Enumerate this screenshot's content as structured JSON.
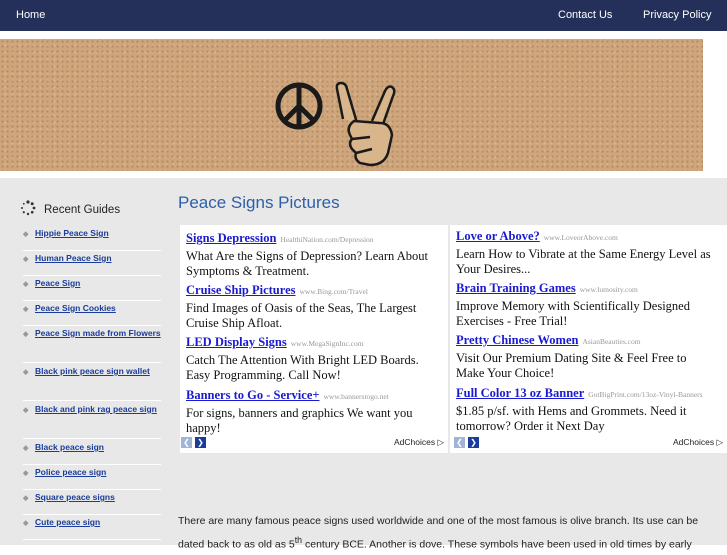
{
  "nav": {
    "home": "Home",
    "contact": "Contact Us",
    "privacy": "Privacy Policy"
  },
  "sidebar": {
    "heading": "Recent Guides",
    "items": [
      "Hippie Peace Sign",
      "Human Peace Sign",
      "Peace Sign",
      "Peace Sign Cookies",
      "Peace Sign made from Flowers",
      "Black pink peace sign wallet",
      "Black and pink rag peace sign",
      "Black peace sign",
      "Police peace sign",
      "Square peace signs",
      "Cute peace sign"
    ]
  },
  "page_title": "Peace Signs Pictures",
  "ads_left": [
    {
      "title": "Signs Depression",
      "url": "HealthiNation.com/Depression",
      "desc": "What Are the Signs of Depression? Learn About Symptoms & Treatment."
    },
    {
      "title": "Cruise Ship Pictures",
      "url": "www.Bing.com/Travel",
      "desc": "Find Images of Oasis of the Seas, The Largest Cruise Ship Afloat."
    },
    {
      "title": "LED Display Signs",
      "url": "www.MegaSignInc.com",
      "desc": "Catch The Attention With Bright LED Boards. Easy Programming. Call Now!"
    },
    {
      "title": "Banners to Go - Service+",
      "url": "www.bannerstogo.net",
      "desc": "For signs, banners and graphics We want you happy!"
    }
  ],
  "ads_right": [
    {
      "title": "Love or Above?",
      "url": "www.LoveorAbove.com",
      "desc": "Learn How to Vibrate at the Same Energy Level as Your Desires..."
    },
    {
      "title": "Brain Training Games",
      "url": "www.lumosity.com",
      "desc": "Improve Memory with Scientifically Designed Exercises - Free Trial!"
    },
    {
      "title": "Pretty Chinese Women",
      "url": "AsianBeauties.com",
      "desc": "Visit Our Premium Dating Site & Feel Free to Make Your Choice!"
    },
    {
      "title": "Full Color 13 oz Banner",
      "url": "GotBigPrint.com/13oz-Vinyl-Banners",
      "desc": "$1.85 p/sf. with Hems and Grommets. Need it tomorrow? Order it Next Day"
    }
  ],
  "adchoices": "AdChoices",
  "arrow_prev": "❮",
  "arrow_next": "❯",
  "body": {
    "line1": "There are many famous peace signs used worldwide and one of the most famous is olive branch. Its use can be",
    "line2a": "dated back to as old as 5",
    "sup": "th",
    "line2b": " century BCE. Another is dove. These symbols have been used in old times by early"
  },
  "colors": {
    "nav_bg": "#24305a",
    "title": "#2d5fa8",
    "ad_link": "#1a1ad0",
    "page_bg": "#e8e8e8"
  }
}
